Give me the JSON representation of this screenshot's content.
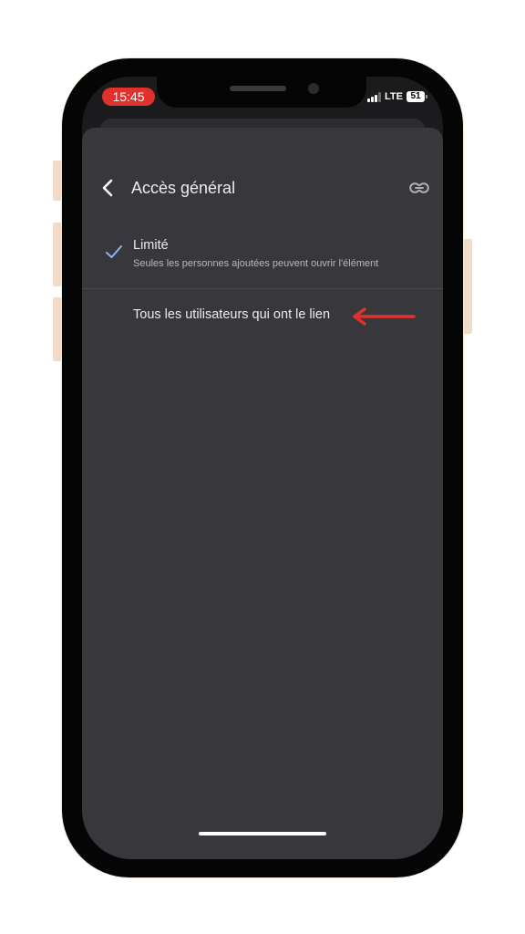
{
  "status_bar": {
    "time": "15:45",
    "network": "LTE",
    "battery": "51"
  },
  "header": {
    "title": "Accès général",
    "back_icon": "chevron-left-icon",
    "link_icon": "link-icon"
  },
  "options": [
    {
      "title": "Limité",
      "subtitle": "Seules les personnes ajoutées peuvent ouvrir l'élément",
      "selected": true
    },
    {
      "title": "Tous les utilisateurs qui ont le lien",
      "selected": false
    }
  ],
  "colors": {
    "sheet_background": "#37373c",
    "check_color": "#8ab4f8",
    "arrow_color": "#e0322d",
    "time_pill": "#e0322d"
  }
}
